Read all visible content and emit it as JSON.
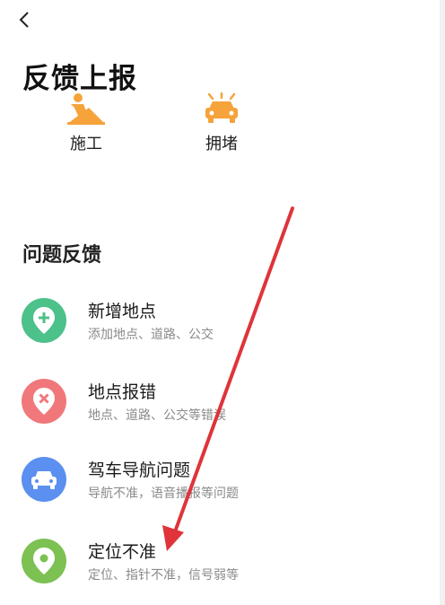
{
  "header": {
    "back_icon": "chevron-left-icon",
    "title": "反馈上报"
  },
  "quick_report": [
    {
      "label": "施工",
      "icon": "construction-worker-icon",
      "color": "#f5a33a"
    },
    {
      "label": "拥堵",
      "icon": "car-traffic-icon",
      "color": "#f5a33a"
    }
  ],
  "feedback": {
    "section_title": "问题反馈",
    "items": [
      {
        "title": "新增地点",
        "subtitle": "添加地点、道路、公交",
        "icon": "location-plus-icon",
        "color": "#4cc18a"
      },
      {
        "title": "地点报错",
        "subtitle": "地点、道路、公交等错误",
        "icon": "location-error-icon",
        "color": "#f0787a"
      },
      {
        "title": "驾车导航问题",
        "subtitle": "导航不准，语音播报等问题",
        "icon": "car-icon",
        "color": "#5b8ff0"
      },
      {
        "title": "定位不准",
        "subtitle": "定位、指针不准，信号弱等",
        "icon": "location-pin-icon",
        "color": "#7cc152"
      }
    ]
  },
  "annotation": {
    "arrow_color": "#e0333a",
    "arrow_icon": "red-arrow-annotation"
  }
}
